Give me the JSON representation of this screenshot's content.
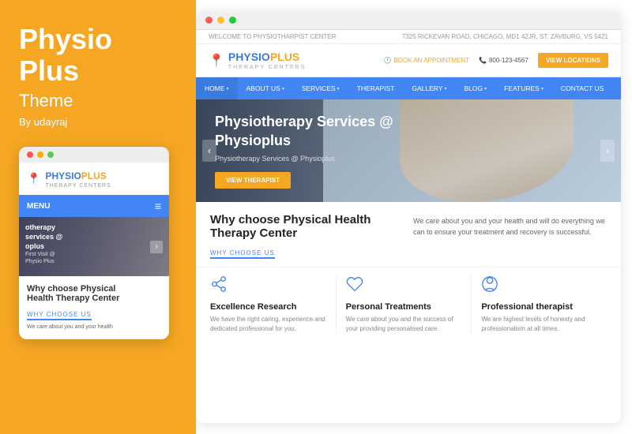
{
  "left": {
    "title_line1": "Physio",
    "title_line2": "Plus",
    "subtitle": "Theme",
    "author": "By udayraj",
    "mobile": {
      "dots": [
        "red",
        "yellow",
        "green"
      ],
      "logo_name": "PHYSIO",
      "logo_plus": "PLUS",
      "logo_sub": "THERAPY CENTERS",
      "nav_label": "MENU",
      "hero_text": "otherapy\nservices @\noplus",
      "hero_sub": "First Visit @\nPhysio Plus",
      "section_title": "Why choose Physical\nHealth Therapy Center",
      "why_label": "WHY CHOOSE US",
      "section_body": "We care about you and your health"
    }
  },
  "right": {
    "browser_dots": [
      "red",
      "yellow",
      "green"
    ],
    "top_bar": {
      "left": "WELCOME TO PHYSIOTHARPIST CENTER",
      "right": "7325 RICKEVAN ROAD, CHICAGO, MD1 42JR, ST. ZAVBURG, VS 5421"
    },
    "header": {
      "logo_name": "PHYSIO",
      "logo_plus": "PLUS",
      "logo_sub": "THERAPY CENTERS",
      "appt_label": "BOOK AN APPOINTMENT",
      "phone": "800-123-4567",
      "view_btn": "VIEW LOCATIONS"
    },
    "nav": {
      "items": [
        {
          "label": "HOME",
          "has_arrow": true
        },
        {
          "label": "ABOUT US",
          "has_arrow": true
        },
        {
          "label": "SERVICES",
          "has_arrow": true
        },
        {
          "label": "THERAPIST",
          "has_arrow": false
        },
        {
          "label": "GALLERY",
          "has_arrow": true
        },
        {
          "label": "BLOG",
          "has_arrow": true
        },
        {
          "label": "FEATURES",
          "has_arrow": true
        },
        {
          "label": "CONTACT US",
          "has_arrow": false
        }
      ]
    },
    "hero": {
      "title_line1": "Physiotherapy Services @",
      "title_line2": "Physioplus",
      "subtitle": "Physiotherapy Services @ Physioplus",
      "btn_label": "VIEW THERAPIST"
    },
    "why": {
      "title": "Why choose Physical Health Therapy Center",
      "label": "WHY CHOOSE US",
      "desc": "We care about you and your health and will do everything we can to ensure your treatment and recovery is successful."
    },
    "features": [
      {
        "icon": "share",
        "title": "Excellence Research",
        "desc": "We have the right caring, experience and dedicated professional for you."
      },
      {
        "icon": "heart",
        "title": "Personal Treatments",
        "desc": "We care about you and the success of your providing personalised care."
      },
      {
        "icon": "person",
        "title": "Professional therapist",
        "desc": "We are highest levels of honesty and professionalism at all times."
      }
    ]
  }
}
